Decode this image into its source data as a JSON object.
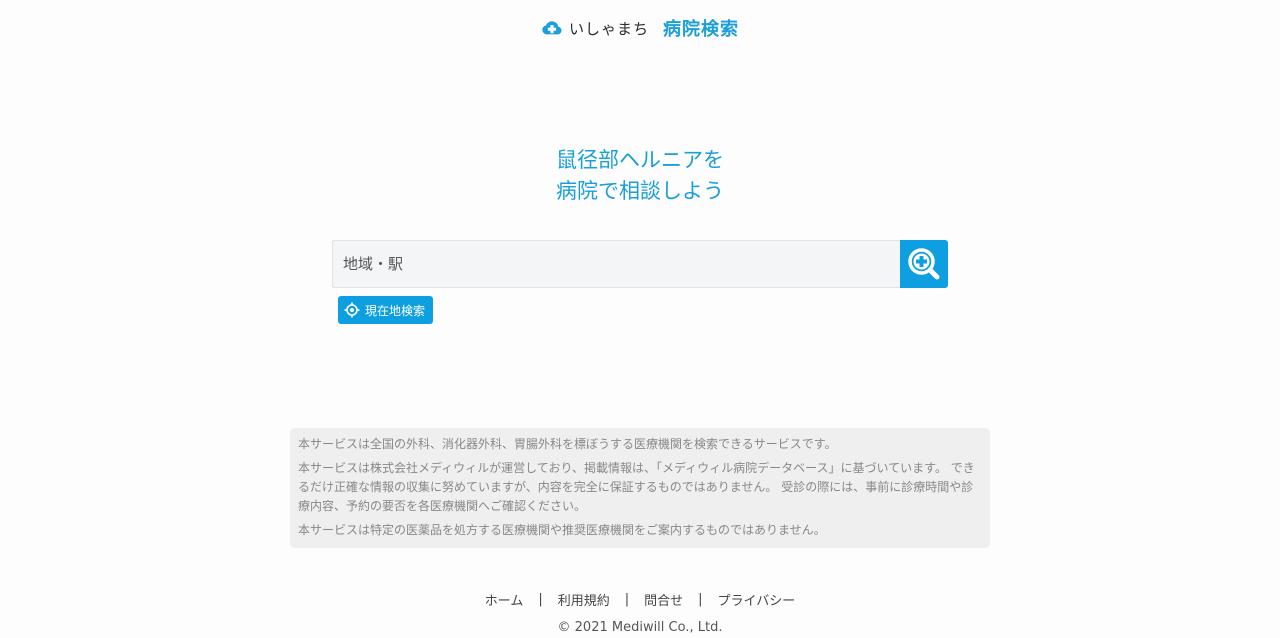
{
  "header": {
    "brand": "いしゃまち",
    "service": "病院検索",
    "logo_icon": "cloud-cross-icon"
  },
  "hero": {
    "line1": "鼠径部ヘルニアを",
    "line2": "病院で相談しよう"
  },
  "search": {
    "placeholder": "地域・駅",
    "value": "",
    "button_icon": "magnifier-cross-icon"
  },
  "geo_search": {
    "label": "現在地検索",
    "icon": "crosshair-icon"
  },
  "notice": {
    "p1": "本サービスは全国の外科、消化器外科、胃腸外科を標ぼうする医療機関を検索できるサービスです。",
    "p2": "本サービスは株式会社メディウィルが運営しており、掲載情報は、「メディウィル病院データベース」に基づいています。 できるだけ正確な情報の収集に努めていますが、内容を完全に保証するものではありません。 受診の際には、事前に診療時間や診療内容、予約の要否を各医療機関へご確認ください。",
    "p3": "本サービスは特定の医薬品を処方する医療機関や推奨医療機関をご案内するものではありません。"
  },
  "footer": {
    "links": [
      "ホーム",
      "利用規約",
      "問合せ",
      "プライバシー"
    ],
    "separator": "|",
    "copyright": "© 2021 Mediwill Co., Ltd."
  },
  "colors": {
    "accent": "#0d9fe0",
    "heading": "#1a9fd9",
    "notice_bg": "#efefef"
  }
}
